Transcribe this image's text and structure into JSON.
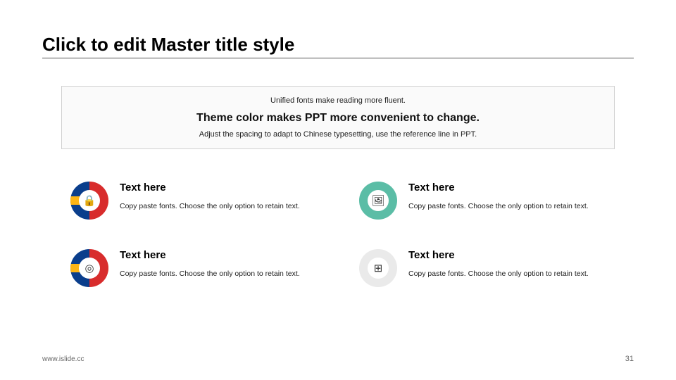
{
  "title": "Click to edit Master title style",
  "info": {
    "line1": "Unified fonts make reading more fluent.",
    "line2": "Theme color makes PPT more convenient to change.",
    "line3": "Adjust the spacing to adapt to Chinese typesetting, use the reference line in PPT."
  },
  "items": [
    {
      "icon": "lock-icon",
      "glyph": "🔒",
      "title": "Text here",
      "desc": "Copy paste fonts. Choose the only option to retain text."
    },
    {
      "icon": "image-icon",
      "glyph": "🖼",
      "title": "Text here",
      "desc": "Copy paste fonts. Choose the only option to retain text."
    },
    {
      "icon": "broadcast-icon",
      "glyph": "◎",
      "title": "Text here",
      "desc": "Copy paste fonts. Choose the only option to retain text."
    },
    {
      "icon": "windows-icon",
      "glyph": "⊞",
      "title": "Text here",
      "desc": "Copy paste fonts. Choose the only option to retain text."
    }
  ],
  "footer": {
    "url": "www.islide.cc",
    "page": "31"
  }
}
